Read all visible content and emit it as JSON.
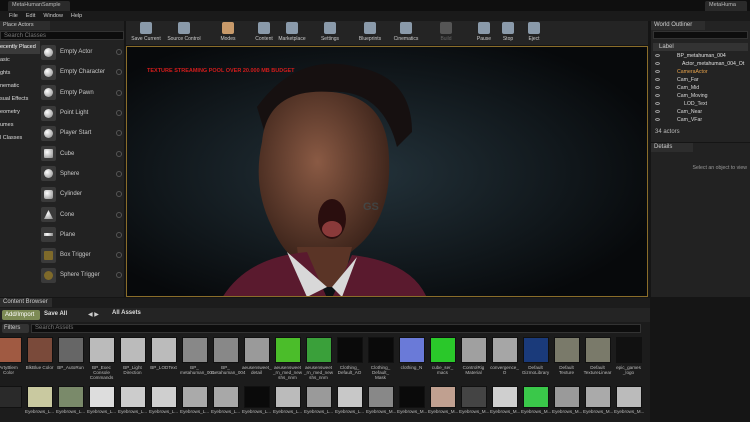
{
  "window": {
    "tab_left": "MetaHumanSample",
    "tab_right": "MetaHuma"
  },
  "menu": [
    "File",
    "Edit",
    "Window",
    "Help"
  ],
  "place_actors": {
    "tab": "Place Actors",
    "search_placeholder": "Search Classes",
    "categories": [
      "ecently Placed",
      "asic",
      "ghts",
      "nematic",
      "sual Effects",
      "eometry",
      "umes",
      "l Classes"
    ],
    "actors": [
      "Empty Actor",
      "Empty Character",
      "Empty Pawn",
      "Point Light",
      "Player Start",
      "Cube",
      "Sphere",
      "Cylinder",
      "Cone",
      "Plane",
      "Box Trigger",
      "Sphere Trigger"
    ]
  },
  "toolbar": [
    "Save Current",
    "Source Control",
    "Modes",
    "Content",
    "Marketplace",
    "Settings",
    "Blueprints",
    "Cinematics",
    "Build",
    "Pause",
    "Stop",
    "Eject"
  ],
  "viewport": {
    "warning": "TEXTURE STREAMING POOL OVER 20.000 MB BUDGET",
    "watermark": "GS"
  },
  "outliner": {
    "tab": "World Outliner",
    "header": "Label",
    "rows": [
      "BP_metahuman_004",
      "Actor_metahuman_004_Ot",
      "CameraActor",
      "Cam_Far",
      "Cam_Mid",
      "Cam_Moving",
      "LOD_Text",
      "Cam_Near",
      "Cam_VFar"
    ],
    "count": "34 actors"
  },
  "details": {
    "tab": "Details",
    "message": "Select an object to view"
  },
  "content_browser": {
    "tab": "Content Browser",
    "add_import": "Add/Import",
    "save_all": "Save All",
    "path": "All Assets",
    "filters": "Filters",
    "search_placeholder": "Search Assets",
    "row1": [
      "ArtyBlem Color",
      "BlkBlue Color",
      "BP_AutoRun",
      "BP_Exec Console Commands",
      "BP_Light Direction",
      "BP_LODText",
      "BP_ metahuman_001",
      "BP_ metahuman_004",
      "aeusensweet_ detail",
      "aeusensweet _rn_med_new shs_nnm",
      "aeusensweet _rn_med_new shs_nnm",
      "Clothing_ Default_AO",
      "Clothing_ Default_ Mask",
      "clothing_N",
      "cube_ser_ macs",
      "ControlRig Material",
      "convergence_ O",
      "Default GizmoLibrary",
      "Default Texture",
      "Default TextureLinear",
      "epic_games _logo"
    ],
    "row2": [
      "",
      "Eyebrows_L...",
      "Eyebrows_L...",
      "Eyebrows_L...",
      "Eyebrows_L...",
      "Eyebrows_L...",
      "Eyebrows_L...",
      "Eyebrows_L...",
      "Eyebrows_L...",
      "Eyebrows_L...",
      "Eyebrows_L...",
      "Eyebrows_L...",
      "Eyebrows_M...",
      "Eyebrows_M...",
      "Eyebrows_M...",
      "Eyebrows_M...",
      "Eyebrows_M...",
      "Eyebrows_M...",
      "Eyebrows_M...",
      "Eyebrows_M...",
      "Eyebrows_M..."
    ]
  }
}
